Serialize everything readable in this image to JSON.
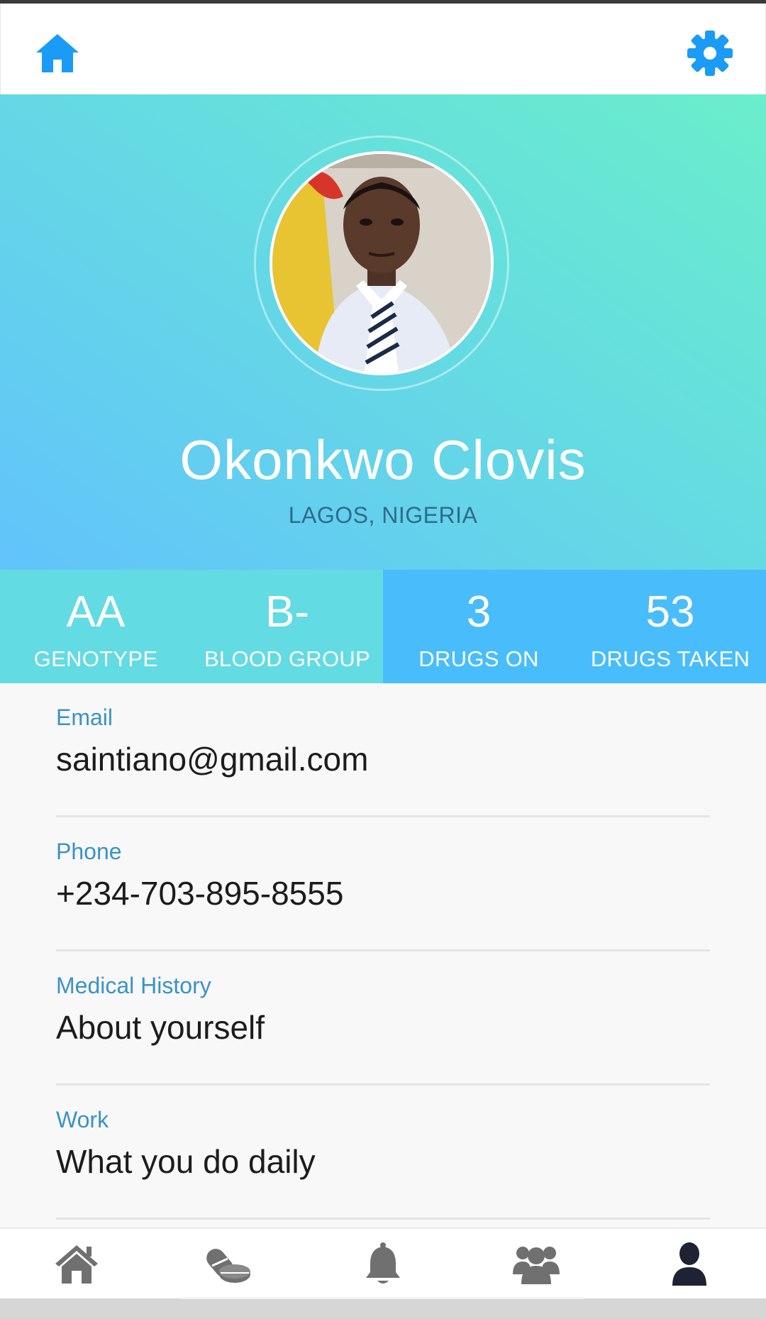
{
  "profile": {
    "name": "Okonkwo Clovis",
    "location": "LAGOS, NIGERIA"
  },
  "stats": [
    {
      "value": "AA",
      "label": "GENOTYPE"
    },
    {
      "value": "B-",
      "label": "BLOOD GROUP"
    },
    {
      "value": "3",
      "label": "DRUGS ON"
    },
    {
      "value": "53",
      "label": "DRUGS TAKEN"
    }
  ],
  "fields": [
    {
      "label": "Email",
      "value": "saintiano@gmail.com"
    },
    {
      "label": "Phone",
      "value": "+234-703-895-8555"
    },
    {
      "label": "Medical History",
      "value": "About yourself"
    },
    {
      "label": "Work",
      "value": "What you do daily"
    }
  ],
  "header": {
    "home_icon": "home-icon",
    "settings_icon": "gear-icon"
  },
  "bottom_nav": {
    "items": [
      "home-icon",
      "pills-icon",
      "bell-icon",
      "users-icon",
      "user-icon"
    ],
    "active": "user-icon"
  },
  "colors": {
    "accent": "#1a9bf5",
    "hero_start": "#62c3fb",
    "hero_end": "#6aeecb",
    "stats_left": "#62dbe3",
    "stats_right": "#49bdfb",
    "field_label": "#3a93c8",
    "nav_inactive": "#707070",
    "nav_active": "#1f2233"
  }
}
